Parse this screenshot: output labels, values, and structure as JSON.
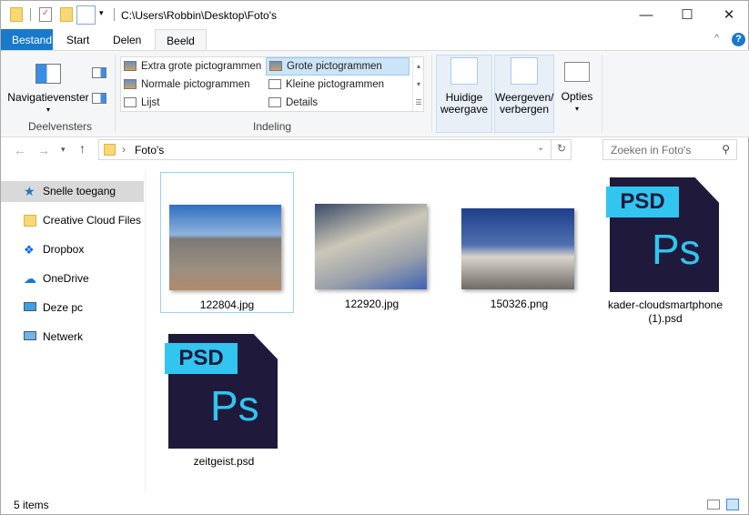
{
  "window": {
    "title": "C:\\Users\\Robbin\\Desktop\\Foto's",
    "minimize": "—",
    "maximize": "☐",
    "close": "✕"
  },
  "tabs": [
    {
      "label": "Bestand"
    },
    {
      "label": "Start"
    },
    {
      "label": "Delen"
    },
    {
      "label": "Beeld"
    }
  ],
  "ribbon": {
    "panes_group": {
      "label": "Deelvensters",
      "nav_pane": "Navigatievenster"
    },
    "layout_group": {
      "label": "Indeling",
      "items": [
        "Extra grote pictogrammen",
        "Grote pictogrammen",
        "Normale pictogrammen",
        "Kleine pictogrammen",
        "Lijst",
        "Details"
      ],
      "selected": "Grote pictogrammen"
    },
    "current_view": {
      "line1": "Huidige",
      "line2": "weergave"
    },
    "show_hide": {
      "line1": "Weergeven/",
      "line2": "verbergen"
    },
    "options": "Opties"
  },
  "address": {
    "path": "Foto's",
    "search_placeholder": "Zoeken in Foto's"
  },
  "nav": [
    {
      "label": "Snelle toegang"
    },
    {
      "label": "Creative Cloud Files"
    },
    {
      "label": "Dropbox"
    },
    {
      "label": "OneDrive"
    },
    {
      "label": "Deze pc"
    },
    {
      "label": "Netwerk"
    }
  ],
  "files": [
    {
      "name": "122804.jpg"
    },
    {
      "name": "122920.jpg"
    },
    {
      "name": "150326.png"
    },
    {
      "name": "kader-cloudsmartphone (1).psd",
      "line1": "kader-cloudsmartphone",
      "line2": "(1).psd"
    },
    {
      "name": "zeitgeist.psd"
    }
  ],
  "psd_badge": "PSD",
  "ps_logo": "Ps",
  "status": {
    "count": "5 items"
  },
  "colors": {
    "accent": "#1979ca",
    "psd_dark": "#1f1a3b",
    "psd_blue": "#31c5f0"
  }
}
